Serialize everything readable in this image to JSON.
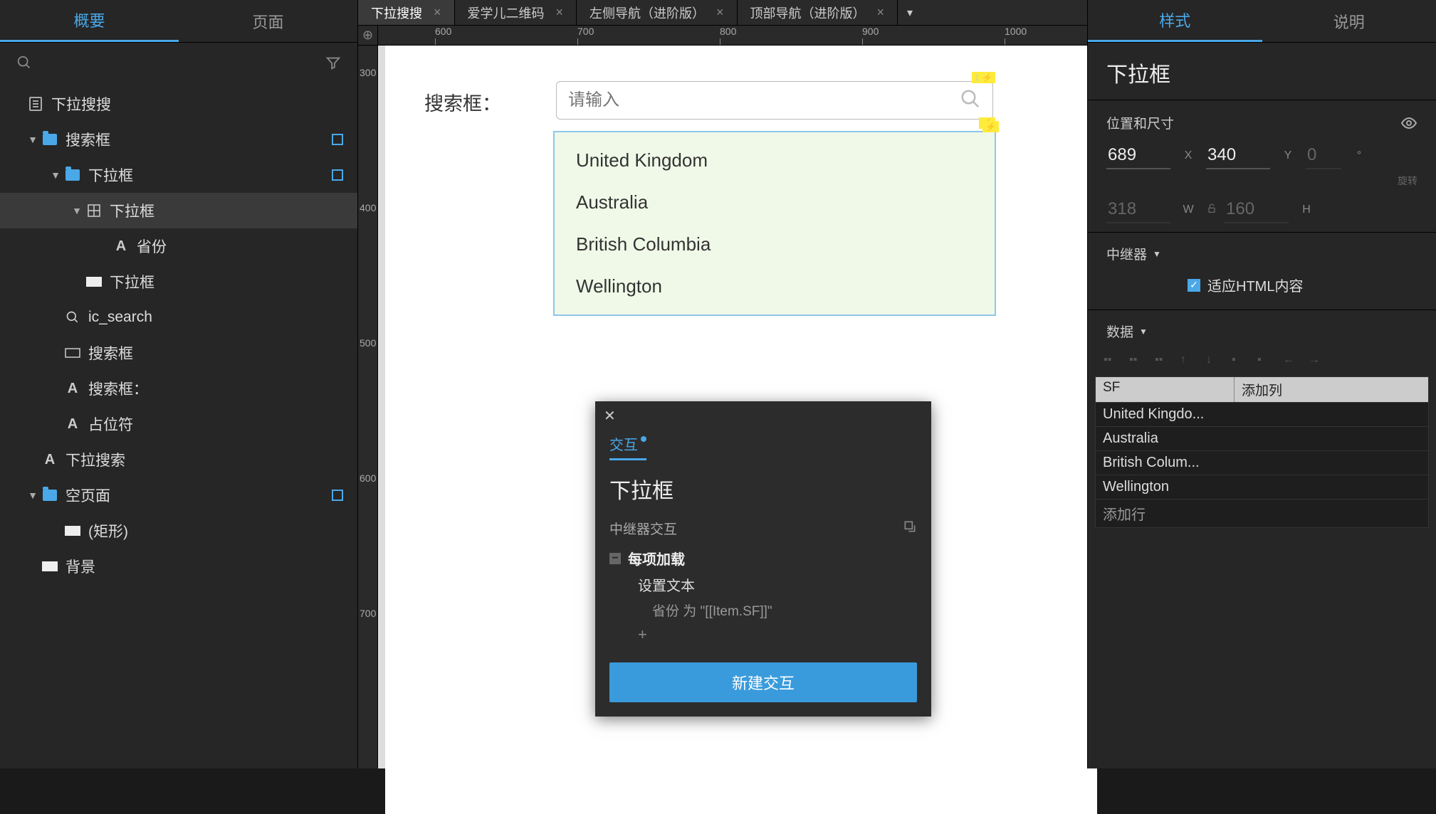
{
  "left": {
    "tabs": [
      "概要",
      "页面"
    ],
    "activeTab": 0,
    "outline": [
      {
        "ind": 0,
        "chev": "",
        "iconType": "page",
        "label": "下拉搜搜",
        "badge": false
      },
      {
        "ind": 1,
        "chev": "▼",
        "iconType": "folder",
        "label": "搜索框",
        "badge": true
      },
      {
        "ind": 2,
        "chev": "▼",
        "iconType": "folder",
        "label": "下拉框",
        "badge": true
      },
      {
        "ind": 3,
        "chev": "▼",
        "iconType": "grid",
        "label": "下拉框",
        "badge": false,
        "selected": true
      },
      {
        "ind": 4,
        "chev": "",
        "iconType": "text",
        "label": "省份",
        "badge": false
      },
      {
        "ind": 3,
        "chev": "",
        "iconType": "rect-white",
        "label": "下拉框",
        "badge": false
      },
      {
        "ind": 2,
        "chev": "",
        "iconType": "search",
        "label": "ic_search",
        "badge": false
      },
      {
        "ind": 2,
        "chev": "",
        "iconType": "rect",
        "label": "搜索框",
        "badge": false
      },
      {
        "ind": 2,
        "chev": "",
        "iconType": "text",
        "label": "搜索框：",
        "badge": false
      },
      {
        "ind": 2,
        "chev": "",
        "iconType": "text",
        "label": "占位符",
        "badge": false
      },
      {
        "ind": 1,
        "chev": "",
        "iconType": "text",
        "label": "下拉搜索",
        "badge": false
      },
      {
        "ind": 1,
        "chev": "▼",
        "iconType": "folder",
        "label": "空页面",
        "badge": true
      },
      {
        "ind": 2,
        "chev": "",
        "iconType": "rect-white",
        "label": "(矩形)",
        "badge": false
      },
      {
        "ind": 1,
        "chev": "",
        "iconType": "rect-white",
        "label": "背景",
        "badge": false
      }
    ]
  },
  "tabs": {
    "items": [
      {
        "label": "下拉搜搜",
        "active": true
      },
      {
        "label": "爱学儿二维码",
        "active": false
      },
      {
        "label": "左侧导航（进阶版）",
        "active": false
      },
      {
        "label": "顶部导航（进阶版）",
        "active": false
      }
    ]
  },
  "ruler": {
    "h": [
      "600",
      "700",
      "800",
      "900",
      "1000"
    ],
    "v": [
      "300",
      "400",
      "500",
      "600",
      "700"
    ]
  },
  "canvas": {
    "searchLabel": "搜索框：",
    "placeholder": "请输入",
    "dropdownItems": [
      "United Kingdom",
      "Australia",
      "British Columbia",
      "Wellington"
    ],
    "noteBadge": "1 ⚡",
    "noteBadge2": "⚡"
  },
  "ix": {
    "tab": "交互",
    "title": "下拉框",
    "section": "中继器交互",
    "event": "每项加载",
    "action": "设置文本",
    "detail": "省份 为 \"[[Item.SF]]\"",
    "newBtn": "新建交互"
  },
  "right": {
    "tabs": [
      "样式",
      "说明"
    ],
    "activeTab": 0,
    "title": "下拉框",
    "posLabel": "位置和尺寸",
    "x": "689",
    "xUnit": "X",
    "y": "340",
    "yUnit": "Y",
    "rot": "0",
    "rotUnit": "°",
    "rotLabel": "旋转",
    "w": "318",
    "wUnit": "W",
    "h": "160",
    "hUnit": "H",
    "repeater": "中继器",
    "fitHtml": "适应HTML内容",
    "dataLabel": "数据",
    "table": {
      "col1": "SF",
      "col2": "添加列",
      "rows": [
        "United Kingdo...",
        "Australia",
        "British Colum...",
        "Wellington"
      ],
      "addRow": "添加行"
    }
  }
}
